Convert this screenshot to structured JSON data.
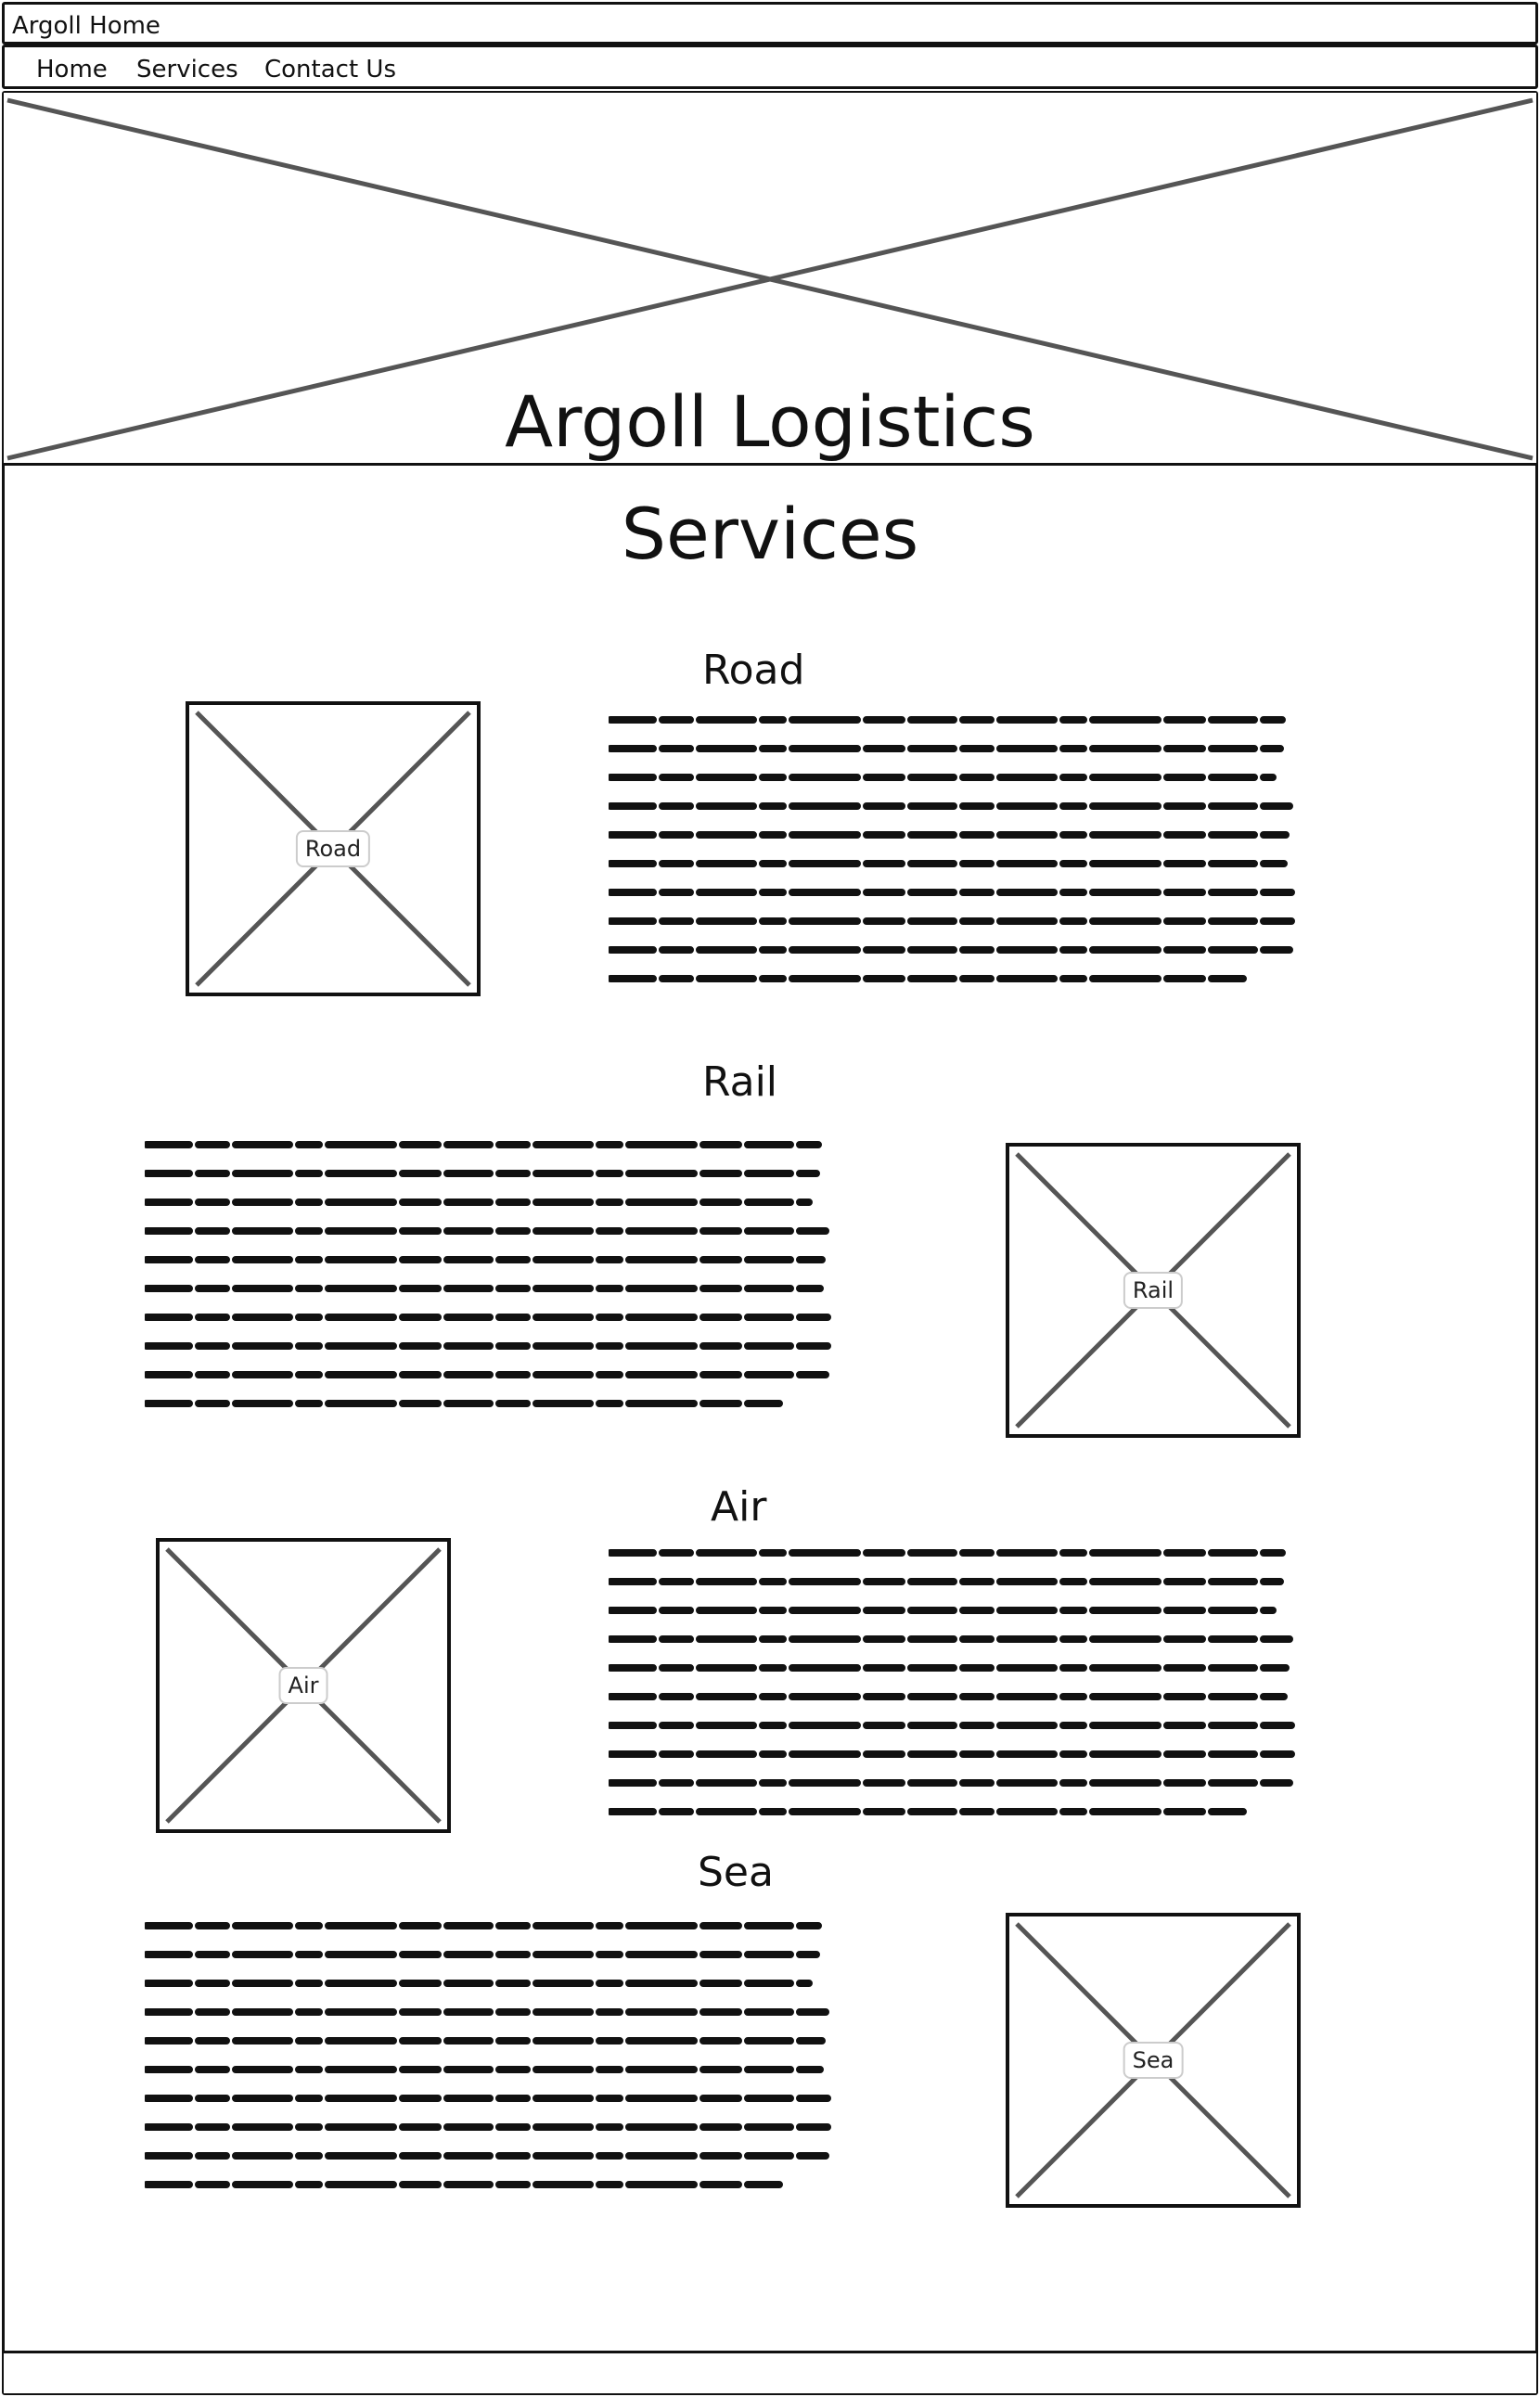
{
  "window": {
    "title": "Argoll Home"
  },
  "nav": {
    "items": [
      {
        "label": "Home"
      },
      {
        "label": "Services"
      },
      {
        "label": "Contact Us"
      }
    ]
  },
  "hero": {
    "title": "Argoll Logistics"
  },
  "page": {
    "title": "Services"
  },
  "services": [
    {
      "heading": "Road",
      "image_label": "Road"
    },
    {
      "heading": "Rail",
      "image_label": "Rail"
    },
    {
      "heading": "Air",
      "image_label": "Air"
    },
    {
      "heading": "Sea",
      "image_label": "Sea"
    }
  ]
}
